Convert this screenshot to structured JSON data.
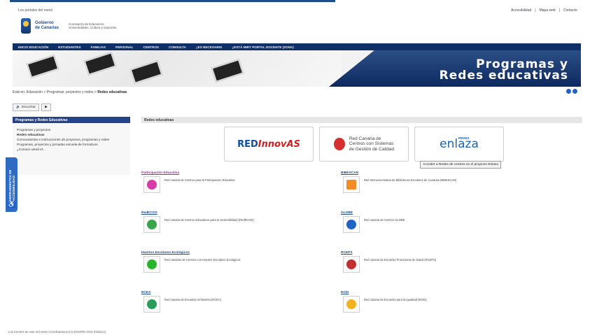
{
  "header": {
    "top_small": "Los portales del menú",
    "gov_line1": "Gobierno",
    "gov_line2": "de Canarias",
    "dept_line1": "Consejería de Educación,",
    "dept_line2": "Universidades, Cultura y Deportes",
    "top_links": [
      "Accesibilidad",
      "Mapa web",
      "Contacto"
    ]
  },
  "navbar": {
    "items": [
      "INICIO EDUCACIÓN",
      "ESTUDIANTES",
      "FAMILIAS",
      "PERSONAL",
      "CENTROS",
      "CONSULTA",
      "¿ES NECESARIO",
      "¿ESTÁ MIRT PORTAL DOCENTE (ZONA)"
    ]
  },
  "banner": {
    "title_line1": "Programas y",
    "title_line2": "Redes educativas"
  },
  "breadcrumb": {
    "text": "Está en: Educación > Programas, proyectos y redes >",
    "current": "Redes educativas"
  },
  "toolbar": {
    "listen_label": "Escuchar",
    "play_label": "▶"
  },
  "sidebar": {
    "title": "Programas y Redes Educativas",
    "items": [
      "Programas y proyectos",
      "Redes educativas",
      "Convocatorias e instrucciones de proyectos, programas y redes",
      "Programas, proyectos y jornadas escuela de formativos",
      "¿Conoce usted el..."
    ]
  },
  "accessibility": {
    "label": "HERRAMIENTAS DE ACCESIBILIDAD",
    "icon": "wheelchair-icon"
  },
  "content": {
    "section_title": "Redes educativas",
    "logos": {
      "innovas_left": "RED",
      "innovas_right": "InnovAS",
      "gestion_line1": "Red Canaria de",
      "gestion_line2": "Centros con Sistemas",
      "gestion_line3": "de Gestión de Calidad",
      "enlaza_small": "REDES",
      "enlaza_title": "enlaza"
    },
    "tooltip": "Acceder a Redes de centros en el proyecto Enlaza",
    "entries": [
      {
        "title": "Participación Educativa",
        "desc": "Red canaria de Centros para la Participación Educativa",
        "icon": "participation-icon",
        "color": "#d83ca8",
        "title_color": "purple"
      },
      {
        "title": "BIBESCAN",
        "desc": "Red Interuniversitaria de Bibliotecas Escolares de Canarias (BIBESCAN)",
        "icon": "library-icon",
        "color": "#f28c28",
        "title_color": "blue"
      },
      {
        "title": "RedECOS",
        "desc": "Red canaria de Centros Educativos para la Sostenibilidad (RedECOS)",
        "icon": "ecos-icon",
        "color": "#3aa64b",
        "title_color": "blue"
      },
      {
        "title": "GLOBE",
        "desc": "Red canaria de Centros GLOBE",
        "icon": "globe-icon",
        "color": "#1f63c4",
        "title_color": "blue"
      },
      {
        "title": "Huertos Escolares Ecológicos",
        "desc": "Red canarias de Centros con Huertos Escolares Ecológicos",
        "icon": "garden-icon",
        "color": "#28b52b",
        "title_color": "blue"
      },
      {
        "title": "RCEPS",
        "desc": "Red canaria de Escuelas Promotoras de Salud (RCEPS)",
        "icon": "health-icon",
        "color": "#c23030",
        "title_color": "blue"
      },
      {
        "title": "RCEA",
        "desc": "Red canaria de Escuelas Ambientes (RCEA)",
        "icon": "environment-icon",
        "color": "#2a9d5a",
        "title_color": "blue"
      },
      {
        "title": "RCEI",
        "desc": "Red canaria de Escuelas para la Igualdad (RCEI)",
        "icon": "equality-icon",
        "color": "#f3b31f",
        "title_color": "blue"
      }
    ]
  },
  "footer": {
    "text": "Los Centros de esta red están Coordinados por la DGOIPE 2018 (Rúbrica)"
  }
}
